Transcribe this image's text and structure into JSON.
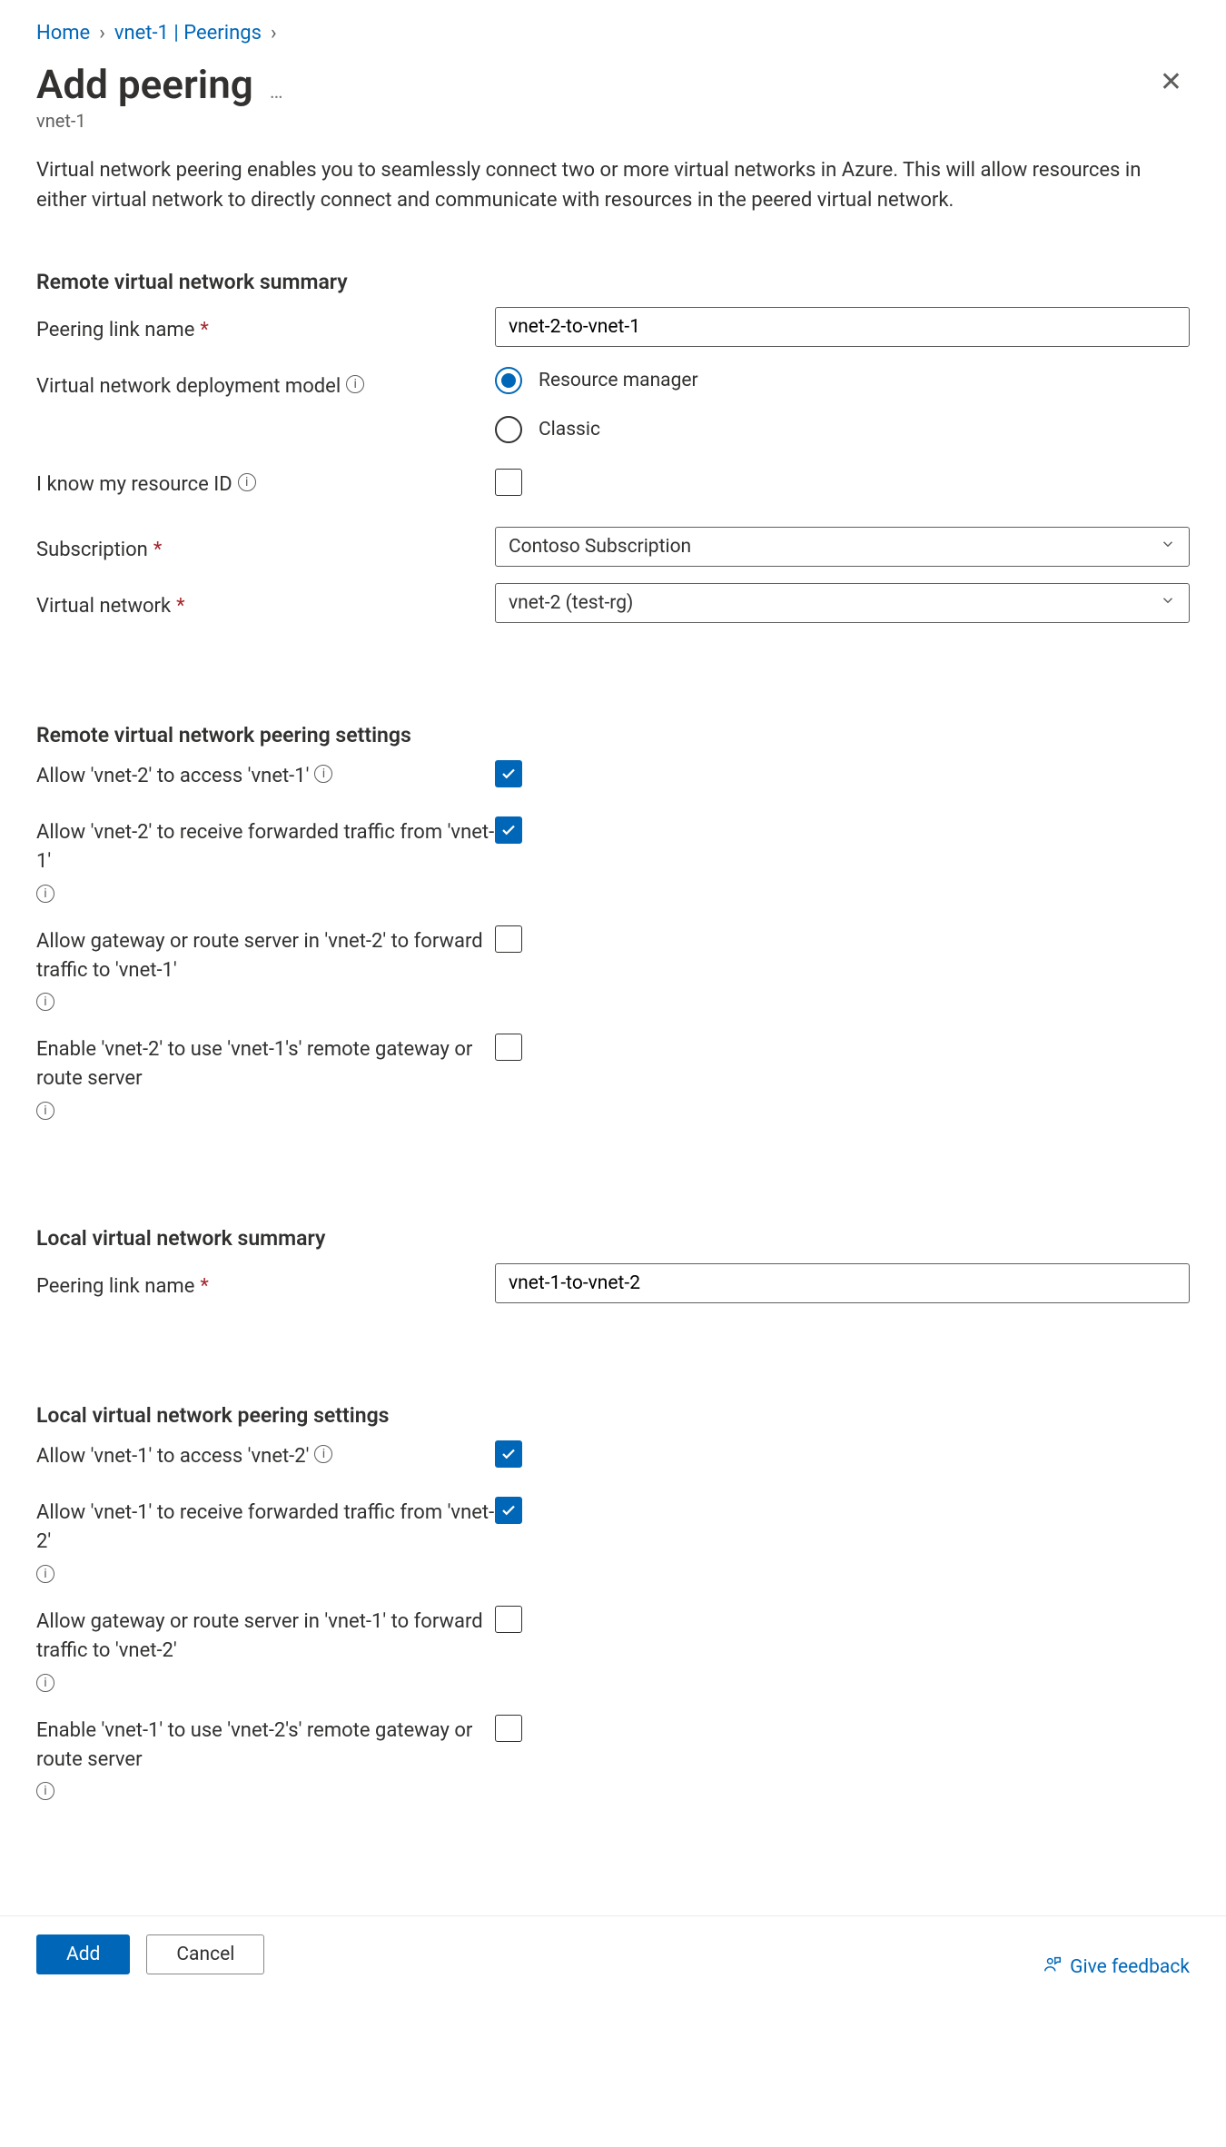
{
  "breadcrumb": {
    "home": "Home",
    "parent": "vnet-1 | Peerings"
  },
  "header": {
    "title": "Add peering",
    "subtitle": "vnet-1"
  },
  "intro": "Virtual network peering enables you to seamlessly connect two or more virtual networks in Azure. This will allow resources in either virtual network to directly connect and communicate with resources in the peered virtual network.",
  "sections": {
    "remote_summary": {
      "heading": "Remote virtual network summary",
      "peering_link_label": "Peering link name",
      "peering_link_value": "vnet-2-to-vnet-1",
      "deploy_model_label": "Virtual network deployment model",
      "deploy_model_opts": {
        "rm": "Resource manager",
        "classic": "Classic"
      },
      "know_id_label": "I know my resource ID",
      "subscription_label": "Subscription",
      "subscription_value": "Contoso Subscription",
      "vnet_label": "Virtual network",
      "vnet_value": "vnet-2 (test-rg)"
    },
    "remote_settings": {
      "heading": "Remote virtual network peering settings",
      "allow_access": "Allow 'vnet-2' to access 'vnet-1'",
      "allow_fwd": "Allow 'vnet-2' to receive forwarded traffic from 'vnet-1'",
      "allow_gateway": "Allow gateway or route server in 'vnet-2' to forward traffic to 'vnet-1'",
      "enable_remote_gw": "Enable 'vnet-2' to use 'vnet-1's' remote gateway or route server"
    },
    "local_summary": {
      "heading": "Local virtual network summary",
      "peering_link_label": "Peering link name",
      "peering_link_value": "vnet-1-to-vnet-2"
    },
    "local_settings": {
      "heading": "Local virtual network peering settings",
      "allow_access": "Allow 'vnet-1' to access 'vnet-2'",
      "allow_fwd": "Allow 'vnet-1' to receive forwarded traffic from 'vnet-2'",
      "allow_gateway": "Allow gateway or route server in 'vnet-1' to forward traffic to 'vnet-2'",
      "enable_remote_gw": "Enable 'vnet-1' to use 'vnet-2's' remote gateway or route server"
    }
  },
  "footer": {
    "add": "Add",
    "cancel": "Cancel",
    "feedback": "Give feedback"
  }
}
